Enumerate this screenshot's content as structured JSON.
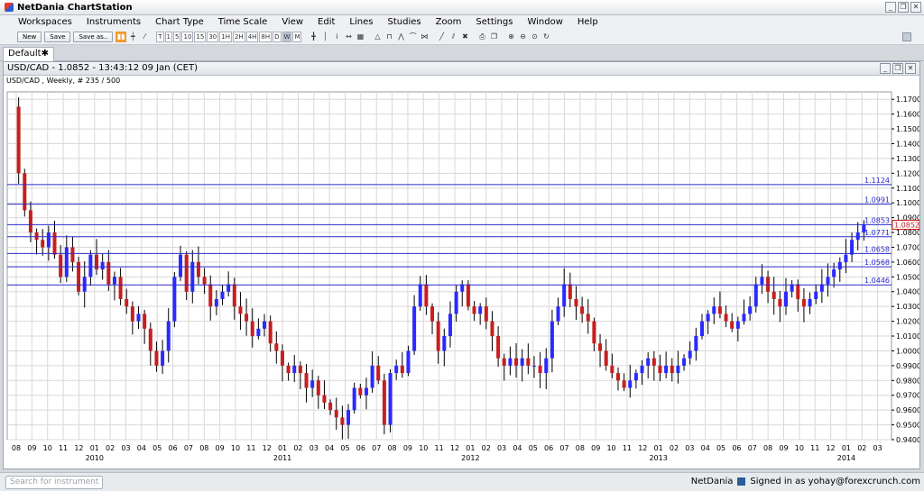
{
  "app": {
    "title": "NetDania ChartStation"
  },
  "window_buttons": [
    "_",
    "❐",
    "✕"
  ],
  "menu": [
    "Workspaces",
    "Instruments",
    "Chart Type",
    "Time Scale",
    "View",
    "Edit",
    "Lines",
    "Studies",
    "Zoom",
    "Settings",
    "Window",
    "Help"
  ],
  "toolbar": {
    "new_label": "New",
    "save_label": "Save",
    "save_as_label": "Save as..",
    "timeframes": [
      "T",
      "1",
      "5",
      "10",
      "15",
      "30",
      "1H",
      "2H",
      "4H",
      "8H",
      "D",
      "W",
      "M"
    ],
    "active_timeframe": "W"
  },
  "tab": {
    "label": "Default",
    "close": "✱"
  },
  "chart_window": {
    "header": "USD/CAD - 1.0852 - 13:43:12  09 Jan (CET)",
    "subheader": "USD/CAD , Weekly, # 235 / 500"
  },
  "status": {
    "search_placeholder": "Search for instrument",
    "brand": "NetDania",
    "signed_in": "Signed in as yohay@forexcrunch.com"
  },
  "colors": {
    "up_candle": "#2a2aff",
    "down_candle": "#c81e1e",
    "hline": "#2a2acc",
    "grid": "#d8d8d8"
  },
  "chart_data": {
    "type": "candlestick",
    "instrument": "USD/CAD",
    "timeframe": "Weekly",
    "last_price": 1.0852,
    "ylim": [
      0.94,
      1.175
    ],
    "y_ticks": [
      0.94,
      0.95,
      0.96,
      0.97,
      0.98,
      0.99,
      1.0,
      1.01,
      1.02,
      1.03,
      1.04,
      1.05,
      1.06,
      1.07,
      1.08,
      1.09,
      1.1,
      1.11,
      1.12,
      1.13,
      1.14,
      1.15,
      1.16,
      1.17
    ],
    "y_tick_labels": [
      "0.9400",
      "0.9500",
      "0.9600",
      "0.9700",
      "0.9800",
      "0.9900",
      "1.0000",
      "1.0100",
      "1.0200",
      "1.0300",
      "1.0400",
      "1.0500",
      "1.0600",
      "1.0700",
      "1.0800",
      "1.0900",
      "1.1000",
      "1.1100",
      "1.1200",
      "1.1300",
      "1.1400",
      "1.1500",
      "1.1600",
      "1.1700"
    ],
    "month_labels": [
      "08",
      "09",
      "10",
      "11",
      "12",
      "01",
      "02",
      "03",
      "04",
      "05",
      "06",
      "07",
      "08",
      "09",
      "10",
      "11",
      "12",
      "01",
      "02",
      "03",
      "04",
      "05",
      "06",
      "07",
      "08",
      "09",
      "10",
      "11",
      "12",
      "01",
      "02",
      "03",
      "04",
      "05",
      "06",
      "07",
      "08",
      "09",
      "10",
      "11",
      "12",
      "01",
      "02",
      "03",
      "04",
      "05",
      "06",
      "07",
      "08",
      "09",
      "10",
      "11",
      "12",
      "01",
      "02",
      "03"
    ],
    "year_labels": [
      {
        "label": "2010",
        "month_index": 5
      },
      {
        "label": "2011",
        "month_index": 17
      },
      {
        "label": "2012",
        "month_index": 29
      },
      {
        "label": "2013",
        "month_index": 41
      },
      {
        "label": "2014",
        "month_index": 53
      }
    ],
    "horizontal_lines": [
      {
        "value": 1.1124,
        "label": "1.1124"
      },
      {
        "value": 1.0991,
        "label": "1.0991"
      },
      {
        "value": 1.0853,
        "label": "1.0853"
      },
      {
        "value": 1.0771,
        "label": "1.0771"
      },
      {
        "value": 1.0658,
        "label": "1.0658"
      },
      {
        "value": 1.0568,
        "label": "1.0568"
      },
      {
        "value": 1.0446,
        "label": "1.0446"
      }
    ],
    "price_path": [
      1.165,
      1.12,
      1.095,
      1.08,
      1.075,
      1.07,
      1.08,
      1.065,
      1.05,
      1.07,
      1.06,
      1.04,
      1.05,
      1.065,
      1.055,
      1.06,
      1.045,
      1.05,
      1.035,
      1.03,
      1.02,
      1.025,
      1.015,
      1.0,
      0.99,
      1.0,
      1.02,
      1.05,
      1.065,
      1.04,
      1.06,
      1.05,
      1.045,
      1.03,
      1.035,
      1.04,
      1.045,
      1.03,
      1.025,
      1.02,
      1.01,
      1.015,
      1.02,
      1.005,
      1.0,
      0.99,
      0.985,
      0.99,
      0.985,
      0.975,
      0.98,
      0.97,
      0.965,
      0.96,
      0.955,
      0.95,
      0.96,
      0.975,
      0.97,
      0.975,
      0.99,
      0.98,
      0.95,
      0.985,
      0.99,
      0.985,
      1.0,
      1.03,
      1.045,
      1.03,
      1.02,
      1.0,
      1.01,
      1.025,
      1.04,
      1.045,
      1.03,
      1.025,
      1.03,
      1.02,
      1.01,
      0.995,
      0.99,
      0.995,
      0.99,
      0.995,
      0.99,
      0.99,
      0.985,
      0.995,
      1.02,
      1.03,
      1.045,
      1.035,
      1.03,
      1.025,
      1.02,
      1.005,
      1.0,
      0.99,
      0.985,
      0.98,
      0.975,
      0.98,
      0.985,
      0.99,
      0.995,
      0.99,
      0.985,
      0.99,
      0.985,
      0.99,
      0.995,
      1.0,
      1.01,
      1.02,
      1.025,
      1.03,
      1.025,
      1.02,
      1.015,
      1.02,
      1.025,
      1.03,
      1.045,
      1.05,
      1.04,
      1.035,
      1.03,
      1.04,
      1.045,
      1.035,
      1.03,
      1.035,
      1.04,
      1.045,
      1.05,
      1.055,
      1.06,
      1.065,
      1.075,
      1.08,
      1.0852
    ]
  }
}
